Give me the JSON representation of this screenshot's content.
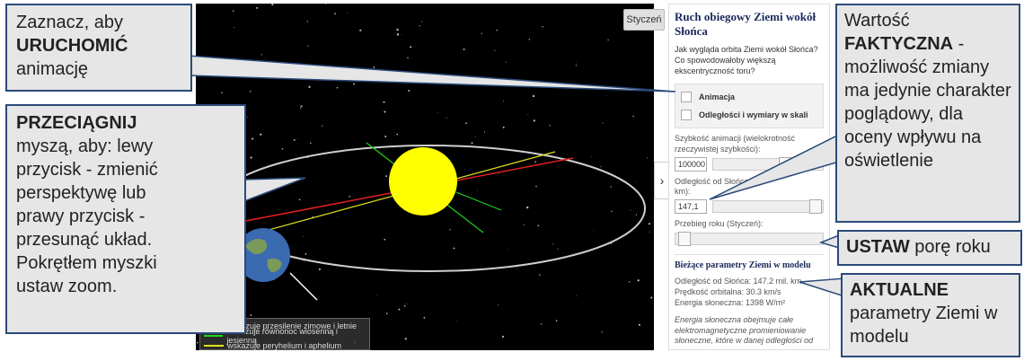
{
  "scene": {
    "month_button": "Styczeń",
    "legend": [
      {
        "color": "#e02020",
        "label": "wskazuje przesilenie zimowe i letnie"
      },
      {
        "color": "#20d020",
        "label": "wskazuje równonoc wiosenną i jesienną"
      },
      {
        "color": "#e0e020",
        "label": "wskazuje peryhelium i aphelium"
      }
    ]
  },
  "panel": {
    "title": "Ruch obiegowy Ziemi wokół Słońca",
    "question": "Jak wygląda orbita Ziemi wokół Słońca? Co spowodowałoby większą ekscentryczność toru?",
    "animation_label": "Animacja",
    "scale_label": "Odległości i wymiary w skali",
    "speed_label": "Szybkość animacji (wielokrotność rzeczywistej szybkości):",
    "speed_value": "100000",
    "distance_label": "Odległość od Słońca w",
    "distance_label2": "km):",
    "distance_value": "147,1",
    "year_label": "Przebieg roku (Styczeń):",
    "current_title": "Bieżące parametry Ziemi w modelu",
    "p1": "Odległość od Słońca: 147.2 mil. km",
    "p2": "Prędkość orbitalna: 30.3 km/s",
    "p3": "Energia słoneczna: 1398 W/m²",
    "note": "Energia słoneczna obejmuje całe elektromagnetyczne promieniowanie słoneczne, które w danej odległości od"
  },
  "callouts": {
    "c1_a": "Zaznacz, aby",
    "c1_b": "URUCHOMIĆ",
    "c1_c": "animację",
    "c2_a": "PRZECIĄGNIJ",
    "c2_b": "myszą, aby: lewy przycisk - zmienić perspektywę lub prawy przycisk - przesunąć układ. Pokrętłem myszki ustaw zoom.",
    "c3_a": "Wartość",
    "c3_b": "FAKTYCZNA",
    "c3_c": " - możliwość zmiany ma jedynie charakter poglądowy, dla oceny wpływu na oświetlenie",
    "c4_a": "USTAW",
    "c4_b": " porę roku",
    "c5_a": "AKTUALNE",
    "c5_b": "parametry Ziemi w modelu"
  },
  "colors": {
    "sun": "#ffff00",
    "earth": "#3a6ab0",
    "callout_border": "#2a4a7a",
    "panel_title": "#1a2a5a"
  }
}
